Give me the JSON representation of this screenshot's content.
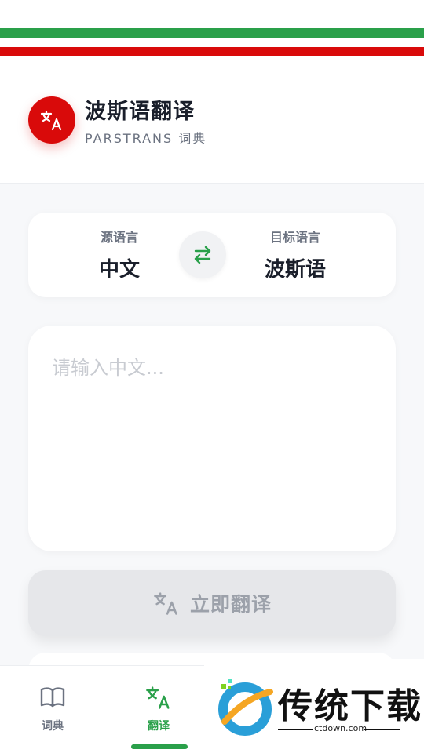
{
  "header": {
    "title": "波斯语翻译",
    "subtitle": "PARSTRANS 词典",
    "logo_icon": "translate-icon"
  },
  "flag_colors": [
    "#2aa04a",
    "#ffffff",
    "#d90a0a"
  ],
  "language_selector": {
    "source_caption": "源语言",
    "source_value": "中文",
    "target_caption": "目标语言",
    "target_value": "波斯语",
    "swap_icon": "swap-arrows-icon"
  },
  "input": {
    "value": "",
    "placeholder": "请输入中文..."
  },
  "translate_button": {
    "label": "立即翻译",
    "icon": "translate-icon"
  },
  "bottom_nav": {
    "items": [
      {
        "label": "词典",
        "icon": "book-icon",
        "active": false
      },
      {
        "label": "翻译",
        "icon": "translate-icon",
        "active": true
      }
    ],
    "active_color": "#2aa04a"
  },
  "watermark": {
    "text": "传统下载",
    "url": "ctdown.com"
  }
}
